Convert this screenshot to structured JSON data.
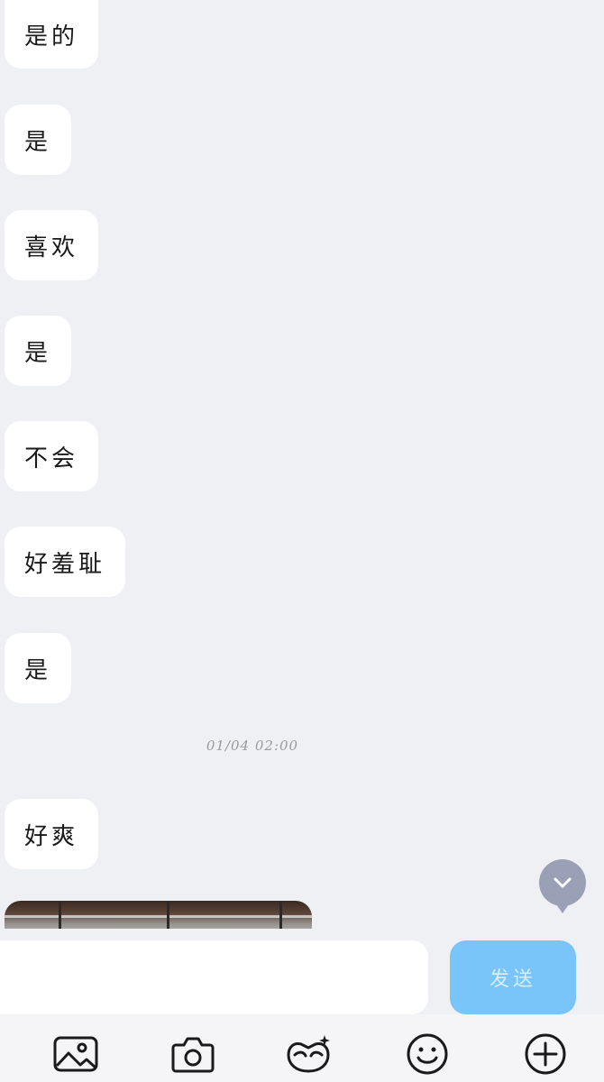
{
  "messages": [
    {
      "text": "是的"
    },
    {
      "text": "是"
    },
    {
      "text": "喜欢"
    },
    {
      "text": "是"
    },
    {
      "text": "不会"
    },
    {
      "text": "好羞耻"
    },
    {
      "text": "是"
    },
    {
      "text": "好爽"
    }
  ],
  "timestamp": "01/04 02:00",
  "input": {
    "value": "",
    "placeholder": ""
  },
  "send_label": "发送",
  "toolbar": [
    {
      "icon": "image-icon"
    },
    {
      "icon": "camera-icon"
    },
    {
      "icon": "sticker-icon"
    },
    {
      "icon": "emoji-icon"
    },
    {
      "icon": "plus-icon"
    }
  ],
  "colors": {
    "background": "#eff0f3",
    "bubble": "#ffffff",
    "send_button": "#79c5f9",
    "scroll_button": "#9aa0b6"
  }
}
